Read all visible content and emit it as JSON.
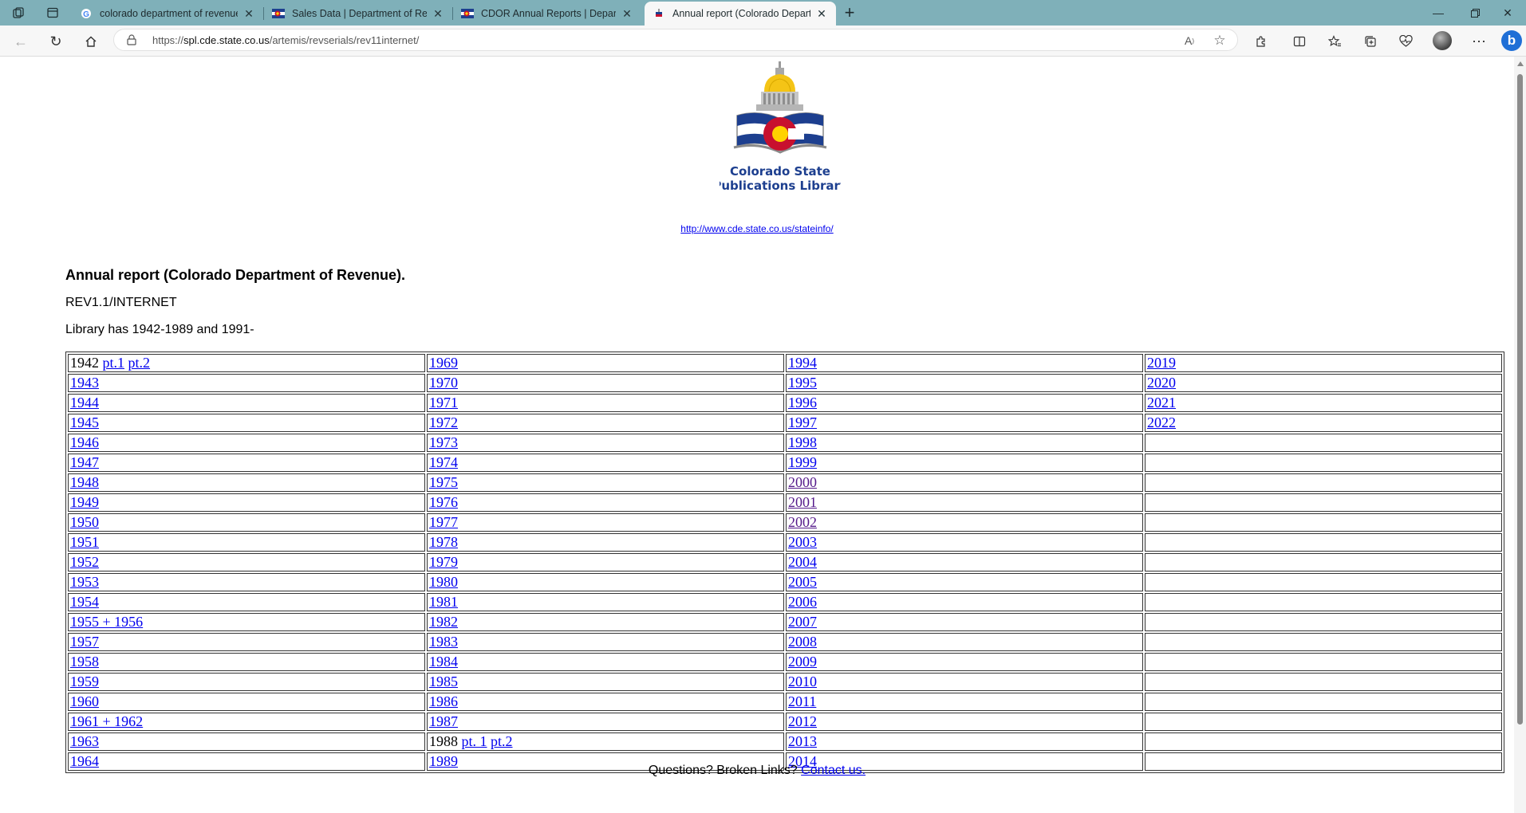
{
  "browser": {
    "tabs": [
      {
        "title": "colorado department of revenue",
        "favicon": "google-icon",
        "active": false
      },
      {
        "title": "Sales Data | Department of Revenue",
        "favicon": "colorado-c-icon",
        "active": false
      },
      {
        "title": "CDOR Annual Reports | Department",
        "favicon": "colorado-c-icon",
        "active": false
      },
      {
        "title": "Annual report (Colorado Department",
        "favicon": "library-icon",
        "active": true
      }
    ],
    "url_prefix": "https://",
    "url_host": "spl.cde.state.co.us",
    "url_path": "/artemis/revserials/rev11internet/",
    "bing_label": "b"
  },
  "page": {
    "logo": {
      "line1": "Colorado State",
      "line2": "Publications Library"
    },
    "logo_link": "http://www.cde.state.co.us/stateinfo/",
    "title": "Annual report (Colorado Department of Revenue).",
    "call_number": "REV1.1/INTERNET",
    "holdings": "Library has 1942-1989 and 1991-",
    "table": {
      "rows": [
        [
          {
            "text": "1942 ",
            "links": [
              {
                "label": "pt.1"
              },
              {
                "label": "pt.2"
              }
            ]
          },
          {
            "links": [
              {
                "label": "1969"
              }
            ]
          },
          {
            "links": [
              {
                "label": "1994"
              }
            ]
          },
          {
            "links": [
              {
                "label": "2019"
              }
            ]
          }
        ],
        [
          {
            "links": [
              {
                "label": "1943"
              }
            ]
          },
          {
            "links": [
              {
                "label": "1970"
              }
            ]
          },
          {
            "links": [
              {
                "label": "1995"
              }
            ]
          },
          {
            "links": [
              {
                "label": "2020"
              }
            ]
          }
        ],
        [
          {
            "links": [
              {
                "label": "1944"
              }
            ]
          },
          {
            "links": [
              {
                "label": "1971"
              }
            ]
          },
          {
            "links": [
              {
                "label": "1996"
              }
            ]
          },
          {
            "links": [
              {
                "label": "2021"
              }
            ]
          }
        ],
        [
          {
            "links": [
              {
                "label": "1945"
              }
            ]
          },
          {
            "links": [
              {
                "label": "1972"
              }
            ]
          },
          {
            "links": [
              {
                "label": "1997"
              }
            ]
          },
          {
            "links": [
              {
                "label": "2022"
              }
            ]
          }
        ],
        [
          {
            "links": [
              {
                "label": "1946"
              }
            ]
          },
          {
            "links": [
              {
                "label": "1973"
              }
            ]
          },
          {
            "links": [
              {
                "label": "1998"
              }
            ]
          },
          {}
        ],
        [
          {
            "links": [
              {
                "label": "1947"
              }
            ]
          },
          {
            "links": [
              {
                "label": "1974"
              }
            ]
          },
          {
            "links": [
              {
                "label": "1999"
              }
            ]
          },
          {}
        ],
        [
          {
            "links": [
              {
                "label": "1948"
              }
            ]
          },
          {
            "links": [
              {
                "label": "1975"
              }
            ]
          },
          {
            "links": [
              {
                "label": "2000",
                "visited": true
              }
            ]
          },
          {}
        ],
        [
          {
            "links": [
              {
                "label": "1949"
              }
            ]
          },
          {
            "links": [
              {
                "label": "1976"
              }
            ]
          },
          {
            "links": [
              {
                "label": "2001",
                "visited": true
              }
            ]
          },
          {}
        ],
        [
          {
            "links": [
              {
                "label": "1950"
              }
            ]
          },
          {
            "links": [
              {
                "label": "1977"
              }
            ]
          },
          {
            "links": [
              {
                "label": "2002",
                "visited": true
              }
            ]
          },
          {}
        ],
        [
          {
            "links": [
              {
                "label": "1951"
              }
            ]
          },
          {
            "links": [
              {
                "label": "1978"
              }
            ]
          },
          {
            "links": [
              {
                "label": "2003"
              }
            ]
          },
          {}
        ],
        [
          {
            "links": [
              {
                "label": "1952"
              }
            ]
          },
          {
            "links": [
              {
                "label": "1979"
              }
            ]
          },
          {
            "links": [
              {
                "label": "2004"
              }
            ]
          },
          {}
        ],
        [
          {
            "links": [
              {
                "label": "1953"
              }
            ]
          },
          {
            "links": [
              {
                "label": "1980"
              }
            ]
          },
          {
            "links": [
              {
                "label": "2005"
              }
            ]
          },
          {}
        ],
        [
          {
            "links": [
              {
                "label": "1954"
              }
            ]
          },
          {
            "links": [
              {
                "label": "1981"
              }
            ]
          },
          {
            "links": [
              {
                "label": "2006"
              }
            ]
          },
          {}
        ],
        [
          {
            "links": [
              {
                "label": "1955 + 1956"
              }
            ]
          },
          {
            "links": [
              {
                "label": "1982"
              }
            ]
          },
          {
            "links": [
              {
                "label": "2007"
              }
            ]
          },
          {}
        ],
        [
          {
            "links": [
              {
                "label": "1957"
              }
            ]
          },
          {
            "links": [
              {
                "label": "1983"
              }
            ]
          },
          {
            "links": [
              {
                "label": "2008"
              }
            ]
          },
          {}
        ],
        [
          {
            "links": [
              {
                "label": "1958"
              }
            ]
          },
          {
            "links": [
              {
                "label": "1984"
              }
            ]
          },
          {
            "links": [
              {
                "label": "2009"
              }
            ]
          },
          {}
        ],
        [
          {
            "links": [
              {
                "label": "1959"
              }
            ]
          },
          {
            "links": [
              {
                "label": "1985"
              }
            ]
          },
          {
            "links": [
              {
                "label": "2010"
              }
            ]
          },
          {}
        ],
        [
          {
            "links": [
              {
                "label": "1960"
              }
            ]
          },
          {
            "links": [
              {
                "label": "1986"
              }
            ]
          },
          {
            "links": [
              {
                "label": "2011"
              }
            ]
          },
          {}
        ],
        [
          {
            "links": [
              {
                "label": "1961 + 1962"
              }
            ]
          },
          {
            "links": [
              {
                "label": "1987"
              }
            ]
          },
          {
            "links": [
              {
                "label": "2012"
              }
            ]
          },
          {}
        ],
        [
          {
            "links": [
              {
                "label": "1963"
              }
            ]
          },
          {
            "text": "1988 ",
            "links": [
              {
                "label": "pt. 1"
              },
              {
                "label": "pt.2"
              }
            ]
          },
          {
            "links": [
              {
                "label": "2013"
              }
            ]
          },
          {}
        ],
        [
          {
            "links": [
              {
                "label": "1964"
              }
            ]
          },
          {
            "links": [
              {
                "label": "1989"
              }
            ]
          },
          {
            "links": [
              {
                "label": "2014"
              }
            ]
          },
          {}
        ]
      ]
    },
    "footer_text": "Questions? Broken Links? ",
    "footer_link": "Contact us."
  },
  "colors": {
    "link": "#0000ee",
    "visited_link": "#551a8b",
    "tabbar": "#7fb0b9"
  }
}
